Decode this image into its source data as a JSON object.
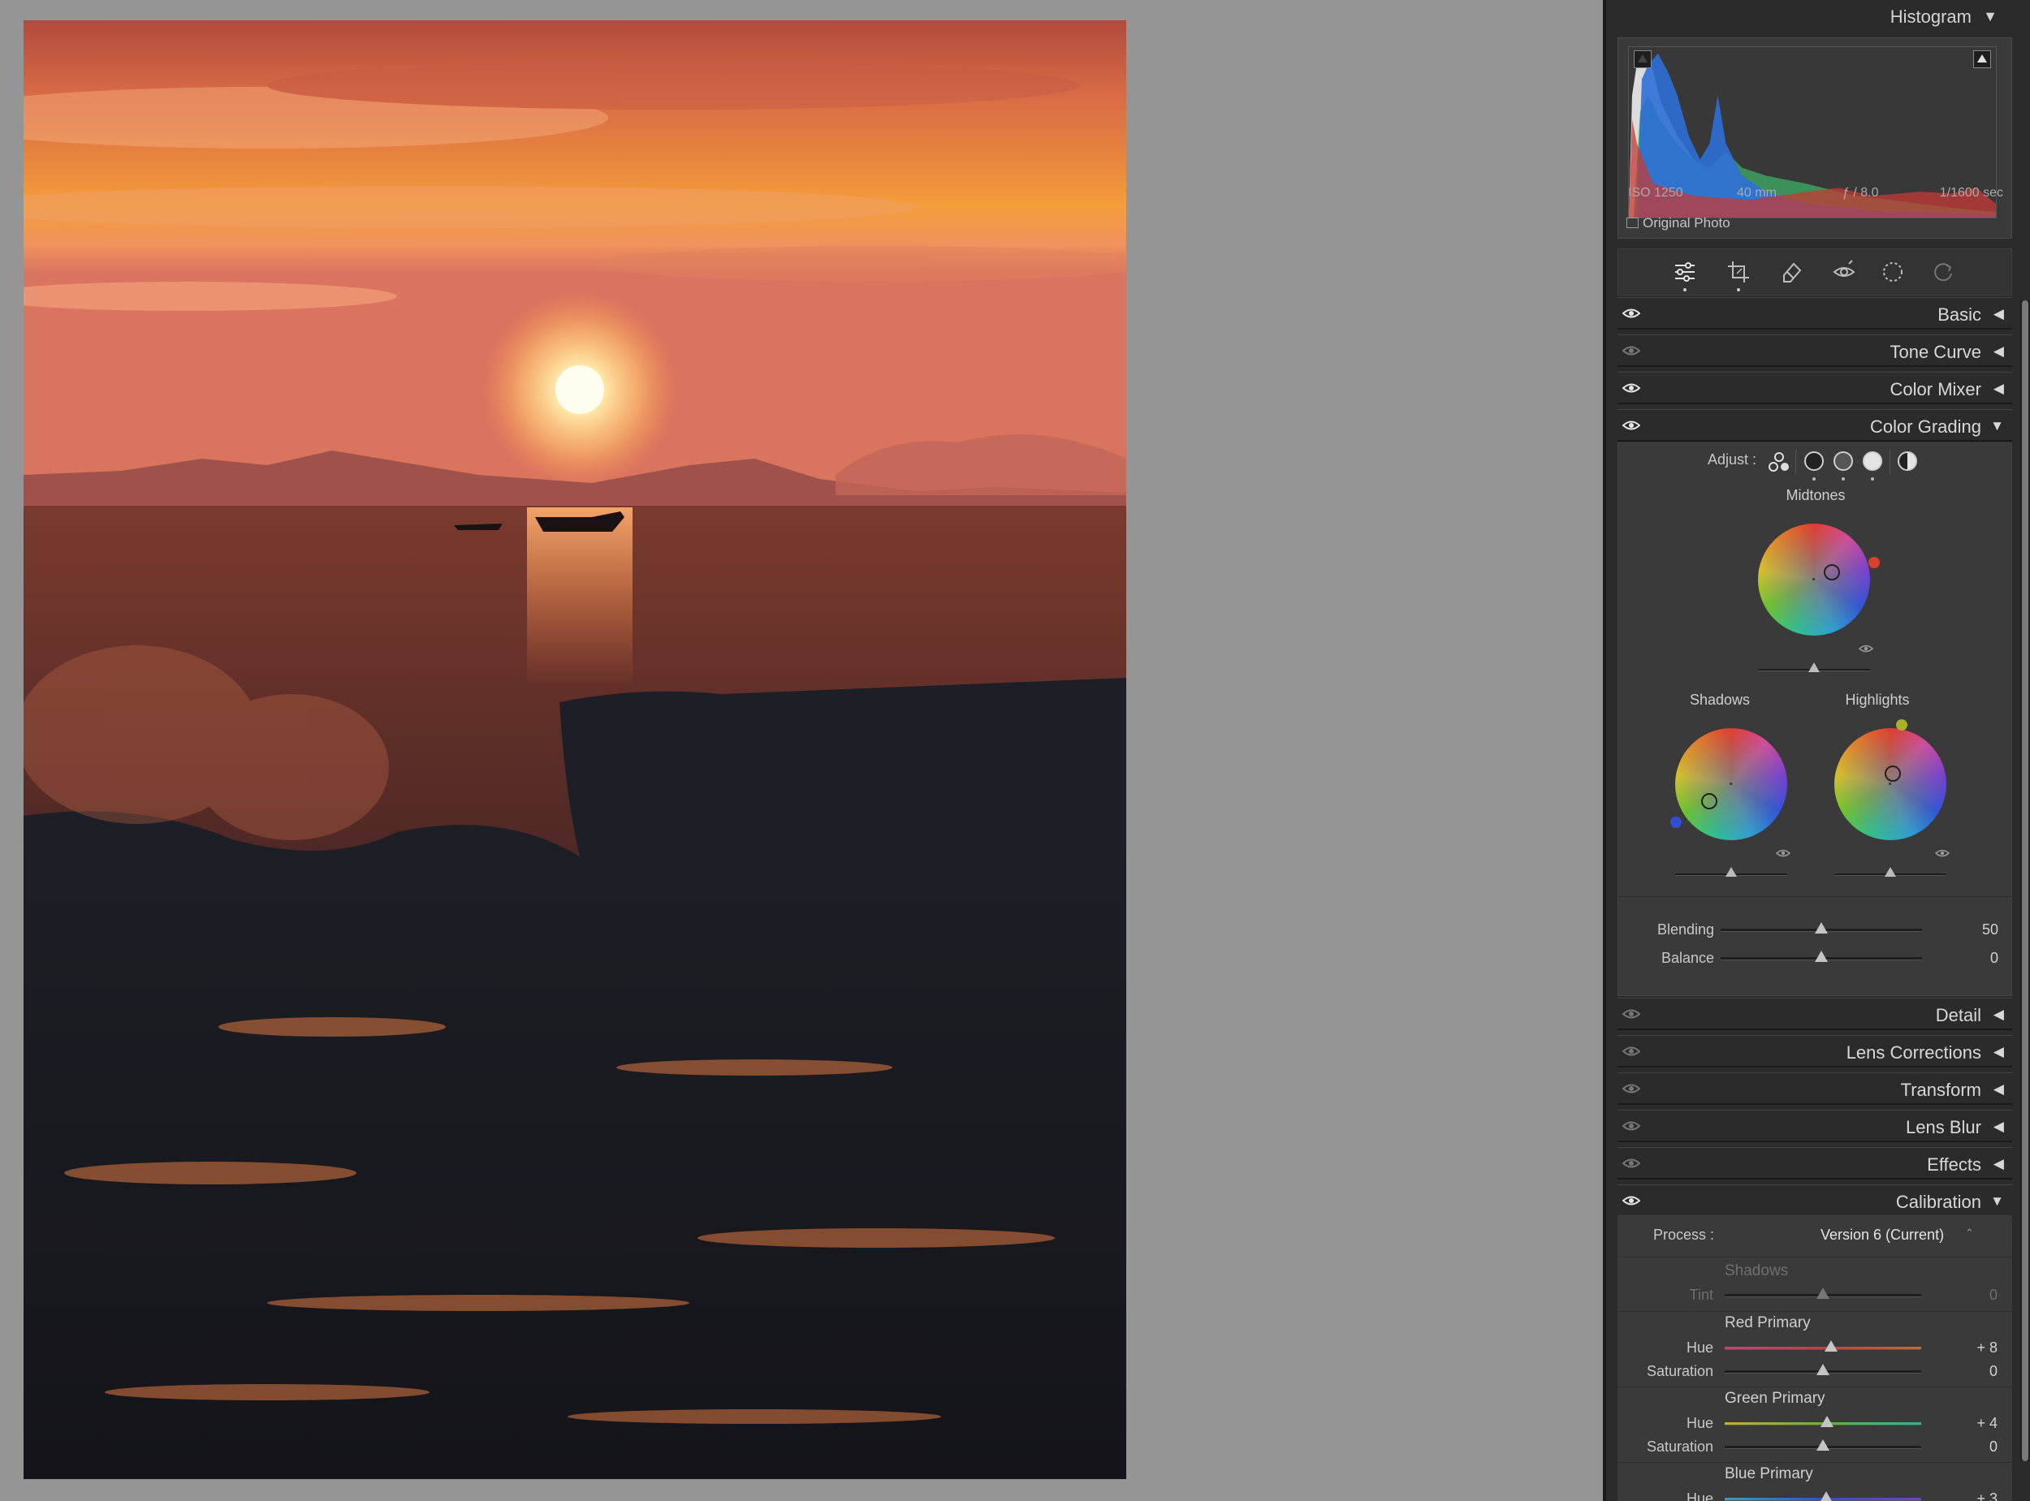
{
  "histogram": {
    "title": "Histogram",
    "collapse_arrow": "▼",
    "exif": {
      "iso": "ISO 1250",
      "focal": "40 mm",
      "aperture": "ƒ / 8.0",
      "shutter": "1/1600 sec"
    },
    "original_photo_label": "Original Photo"
  },
  "tools": [
    "edit-sliders-icon",
    "crop-icon",
    "healing-icon",
    "red-eye-icon",
    "masking-icon",
    "presets-icon"
  ],
  "sections": {
    "basic": "Basic",
    "tone_curve": "Tone Curve",
    "color_mixer": "Color Mixer",
    "color_grading": "Color Grading",
    "detail": "Detail",
    "lens_corrections": "Lens Corrections",
    "transform": "Transform",
    "lens_blur": "Lens Blur",
    "effects": "Effects",
    "calibration": "Calibration"
  },
  "arrows": {
    "collapsed": "◀",
    "expanded": "▼"
  },
  "color_grading": {
    "adjust_label": "Adjust :",
    "midtones_label": "Midtones",
    "shadows_label": "Shadows",
    "highlights_label": "Highlights",
    "blending_label": "Blending",
    "blending_value": "50",
    "balance_label": "Balance",
    "balance_value": "0",
    "blending": 50,
    "balance": 0,
    "handle_colors": {
      "midtones": "#d6432c",
      "shadows": "#3050d0",
      "highlights": "#a8b02a"
    }
  },
  "calibration": {
    "process_label": "Process :",
    "process_value": "Version 6 (Current)",
    "process_chevron": "⌃",
    "shadows_label": "Shadows",
    "tint_label": "Tint",
    "tint_value": "0",
    "red_primary_label": "Red Primary",
    "red_hue_label": "Hue",
    "red_hue_value": "+ 8",
    "red_sat_label": "Saturation",
    "red_sat_value": "0",
    "green_primary_label": "Green Primary",
    "green_hue_label": "Hue",
    "green_hue_value": "+ 4",
    "green_sat_label": "Saturation",
    "green_sat_value": "0",
    "blue_primary_label": "Blue Primary",
    "blue_hue_label": "Hue",
    "blue_hue_value": "+ 3",
    "tint": 0,
    "red_hue": 8,
    "red_saturation": 0,
    "green_hue": 4,
    "green_saturation": 0,
    "blue_hue": 3
  }
}
